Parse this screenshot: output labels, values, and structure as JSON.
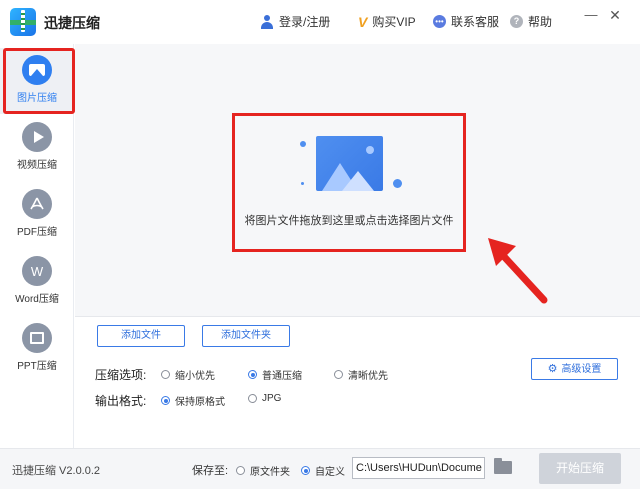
{
  "app": {
    "title": "迅捷压缩",
    "version": "迅捷压缩 V2.0.0.2"
  },
  "topnav": {
    "login": "登录/注册",
    "vip": "购买VIP",
    "service": "联系客服",
    "help": "帮助",
    "min_symbol": "—",
    "close_symbol": "✕"
  },
  "sidebar": {
    "items": [
      {
        "label": "图片压缩",
        "icon": "image-icon",
        "active": true
      },
      {
        "label": "视频压缩",
        "icon": "play-icon",
        "active": false
      },
      {
        "label": "PDF压缩",
        "icon": "pdf-icon",
        "active": false
      },
      {
        "label": "Word压缩",
        "icon": "word-icon",
        "glyph": "W",
        "active": false
      },
      {
        "label": "PPT压缩",
        "icon": "ppt-icon",
        "active": false
      }
    ]
  },
  "dropzone": {
    "text": "将图片文件拖放到这里或点击选择图片文件"
  },
  "actions": {
    "add_file": "添加文件",
    "add_folder": "添加文件夹",
    "advanced": "高级设置"
  },
  "compress": {
    "label": "压缩选项:",
    "options": [
      {
        "label": "缩小优先",
        "selected": false
      },
      {
        "label": "普通压缩",
        "selected": true
      },
      {
        "label": "清晰优先",
        "selected": false
      }
    ]
  },
  "output": {
    "label": "输出格式:",
    "options": [
      {
        "label": "保持原格式",
        "selected": true
      },
      {
        "label": "JPG",
        "selected": false
      }
    ]
  },
  "save": {
    "label": "保存至:",
    "options": [
      {
        "label": "原文件夹",
        "selected": false
      },
      {
        "label": "自定义",
        "selected": true
      }
    ],
    "path": "C:\\Users\\HUDun\\Docume"
  },
  "start_button": "开始压缩",
  "colors": {
    "accent": "#2f7ff0",
    "highlight_red": "#e52420",
    "disabled_button": "#cfd3da"
  }
}
